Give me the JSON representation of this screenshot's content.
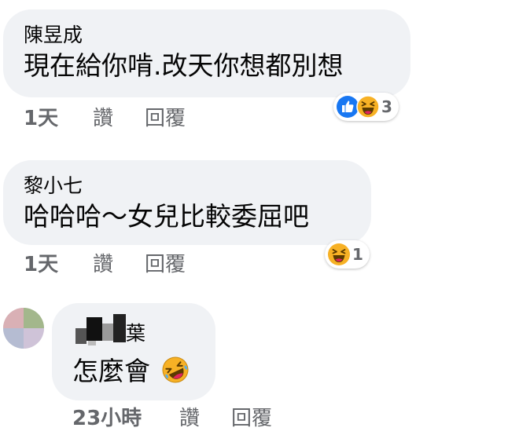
{
  "comments": [
    {
      "author": "陳昱成",
      "text": "現在給你啃.改天你想都別想",
      "time": "1天",
      "like_action": "讚",
      "reply_action": "回覆",
      "reactions": [
        "like",
        "haha"
      ],
      "reaction_count": "3"
    },
    {
      "author": "黎小七",
      "text": "哈哈哈～女兒比較委屈吧",
      "time": "1天",
      "like_action": "讚",
      "reply_action": "回覆",
      "reactions": [
        "haha"
      ],
      "reaction_count": "1"
    },
    {
      "author": "葉",
      "text": "怎麼會",
      "emoji": "rolling-on-floor-laughing",
      "time": "23小時",
      "like_action": "讚",
      "reply_action": "回覆"
    }
  ],
  "colors": {
    "bubble": "#f0f2f5",
    "meta_text": "#65676b",
    "like_blue": "#1877f2",
    "haha_yellow": "#f7b125"
  }
}
